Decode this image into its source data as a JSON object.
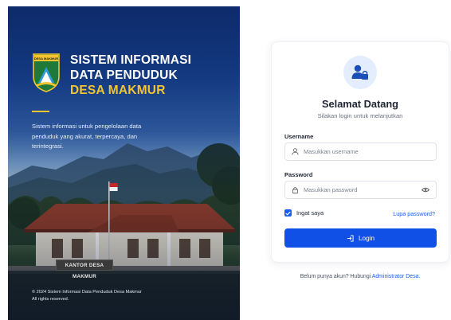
{
  "hero": {
    "brand_line1": "SISTEM INFORMASI",
    "brand_line2": "DATA PENDUDUK",
    "brand_line3": "DESA MAKMUR",
    "emblem_text": "DESA MAKMUR",
    "tagline": "Sistem informasi untuk pengelolaan data penduduk yang akurat, terpercaya, dan terintegrasi.",
    "sign_text": "KANTOR DESA MAKMUR",
    "copyright_line1": "© 2024 Sistem Informasi Data Penduduk Desa Makmur",
    "copyright_line2": "All rights reserved.",
    "accent_color": "#f4c430"
  },
  "login": {
    "title": "Selamat Datang",
    "subtitle": "Silakan login untuk melanjutkan",
    "username_label": "Username",
    "username_placeholder": "Masukkan username",
    "password_label": "Password",
    "password_placeholder": "Masukkan password",
    "remember_label": "Ingat saya",
    "remember_checked": true,
    "forgot_label": "Lupa password?",
    "login_button": "Login",
    "primary_color": "#1150e6"
  },
  "footer": {
    "prefix": "Belum punya akun? Hubungi ",
    "link": "Administrator Desa."
  },
  "icons": [
    "emblem-icon",
    "user-lock-icon",
    "user-icon",
    "lock-icon",
    "eye-icon",
    "check-icon",
    "login-icon"
  ]
}
